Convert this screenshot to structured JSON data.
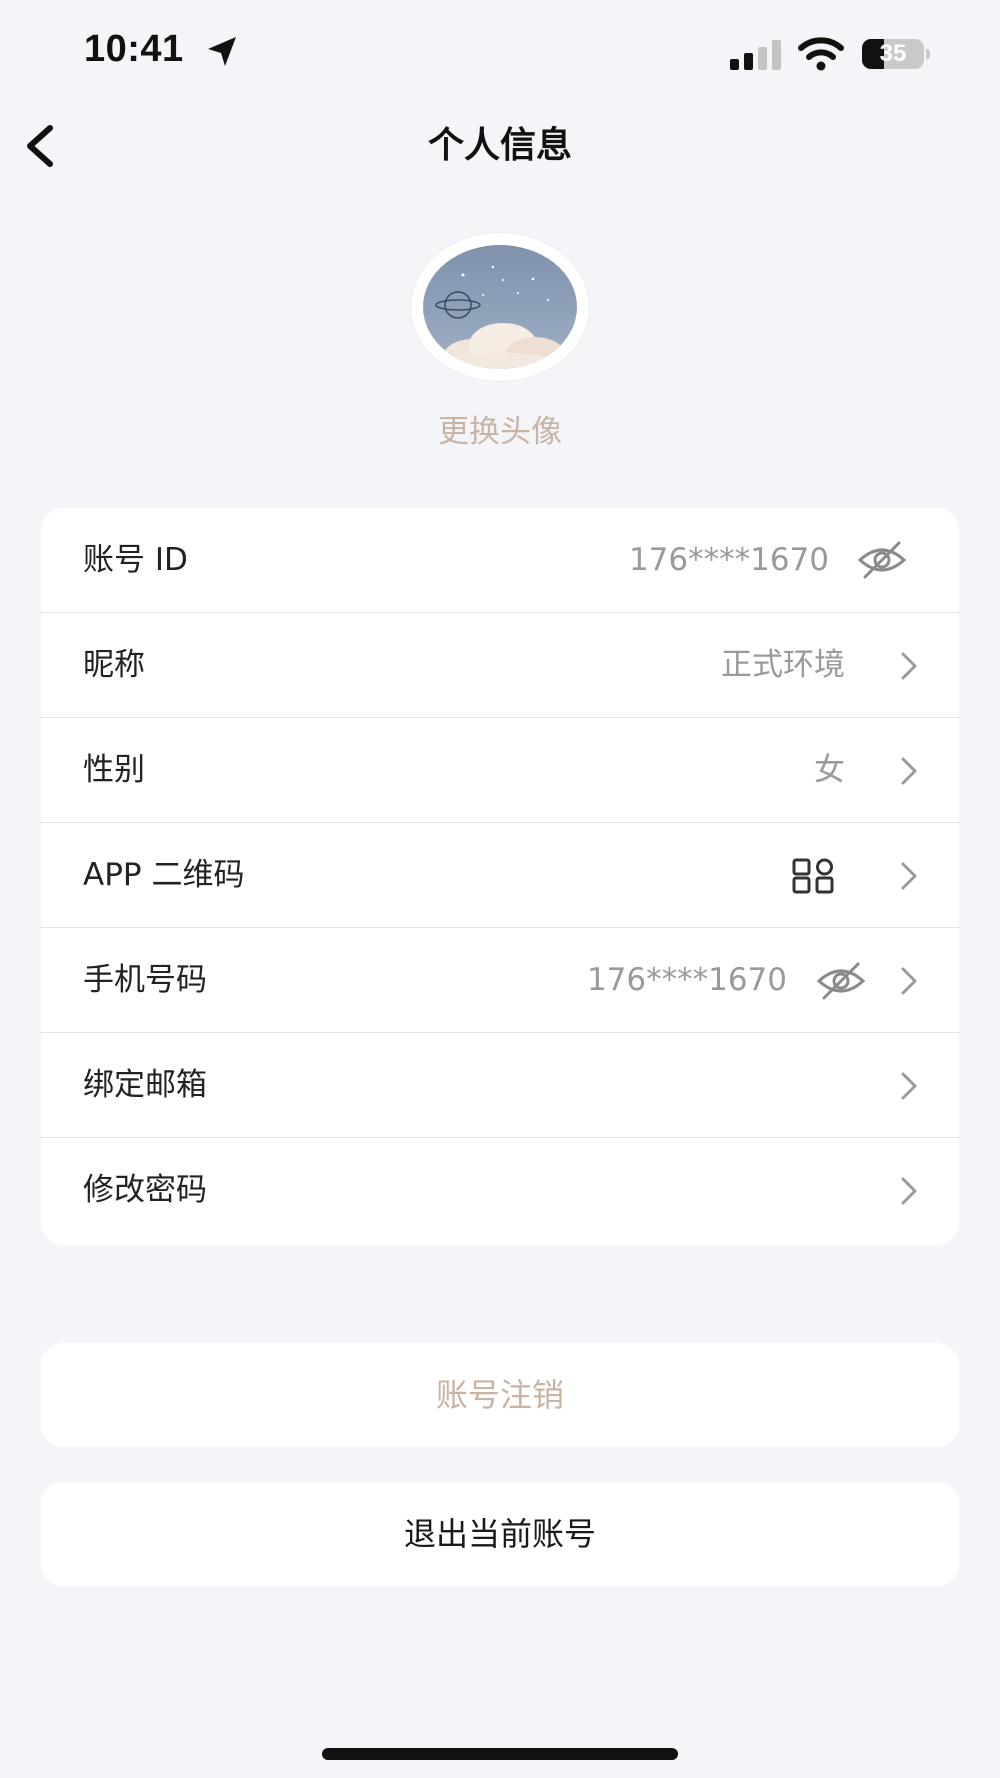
{
  "status_bar": {
    "time": "10:41",
    "battery_level": "35",
    "icons": [
      "location-arrow-icon",
      "signal-icon",
      "wifi-icon",
      "battery-icon"
    ]
  },
  "nav": {
    "title": "个人信息",
    "back_icon": "chevron-left-icon"
  },
  "avatar": {
    "change_label": "更换头像"
  },
  "rows": {
    "account_id": {
      "label": "账号 ID",
      "value": "176****1670"
    },
    "nickname": {
      "label": "昵称",
      "value": "正式环境"
    },
    "gender": {
      "label": "性别",
      "value": "女"
    },
    "qrcode": {
      "label": "APP 二维码"
    },
    "phone": {
      "label": "手机号码",
      "value": "176****1670"
    },
    "email": {
      "label": "绑定邮箱"
    },
    "password": {
      "label": "修改密码"
    }
  },
  "buttons": {
    "delete_account": "账号注销",
    "logout": "退出当前账号"
  },
  "colors": {
    "background": "#F4F5F9",
    "accent_muted": "#C9B4A3",
    "card": "#FFFFFF",
    "value_text": "#9A9A9A"
  }
}
